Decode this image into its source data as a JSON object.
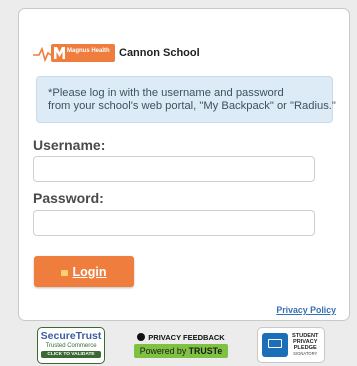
{
  "brand": {
    "logo_text": "Magnus Health",
    "school_name": "Cannon School"
  },
  "notice": {
    "line1": "*Please log in with the username and password",
    "line2": "from your school's web portal, \"My Backpack\" or \"Radius.\""
  },
  "form": {
    "username_label": "Username:",
    "username_value": "",
    "password_label": "Password:",
    "password_value": ""
  },
  "login_button": {
    "label": "Login",
    "icon": "lock-icon"
  },
  "links": {
    "privacy_policy": "Privacy Policy"
  },
  "badges": {
    "securetrust": {
      "title": "SecureTrust",
      "subtitle": "Trusted Commerce",
      "cta": "CLICK TO VALIDATE"
    },
    "truste": {
      "top": "PRIVACY FEEDBACK",
      "bottom_prefix": "Powered by ",
      "bottom_brand": "TRUSTe"
    },
    "pledge": {
      "line1": "STUDENT",
      "line2": "PRIVACY",
      "line3": "PLEDGE",
      "line4": "SIGNATORY"
    }
  },
  "colors": {
    "accent": "#ef7d3e",
    "notice_bg": "#dcebf6",
    "link": "#3470b4",
    "truste_green": "#7fc242"
  }
}
